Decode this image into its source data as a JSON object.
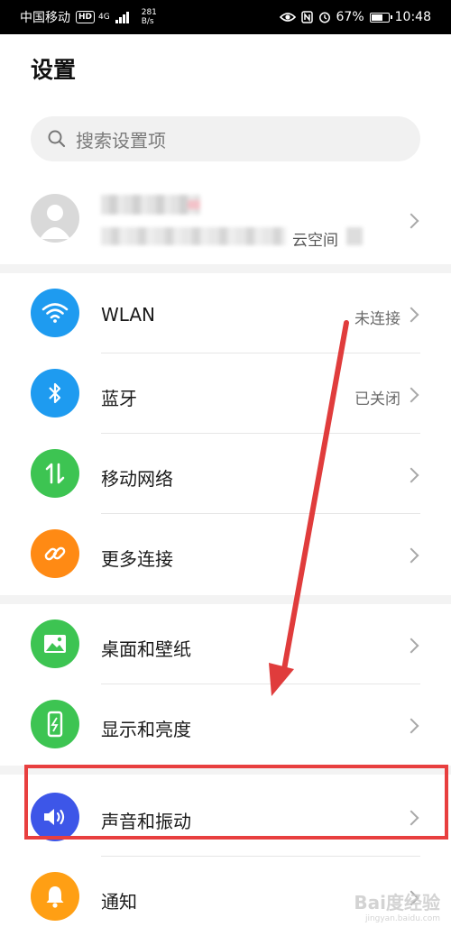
{
  "status_bar": {
    "carrier": "中国移动",
    "hd_badge": "HD",
    "network": "4G",
    "speed_value": "281",
    "speed_unit": "B/s",
    "battery": "67%",
    "time": "10:48",
    "icons": [
      "eye-comfort-icon",
      "nfc-icon",
      "alarm-icon",
      "battery-icon"
    ]
  },
  "page": {
    "title": "设置"
  },
  "search": {
    "placeholder": "搜索设置项"
  },
  "account": {
    "sub_text_visible": "云空间"
  },
  "groups": [
    {
      "items": [
        {
          "id": "wlan",
          "label": "WLAN",
          "status": "未连接",
          "icon": "wifi-icon",
          "color": "#1e9bf0"
        },
        {
          "id": "bluetooth",
          "label": "蓝牙",
          "status": "已关闭",
          "icon": "bluetooth-icon",
          "color": "#1e9bf0"
        },
        {
          "id": "mobile-network",
          "label": "移动网络",
          "status": "",
          "icon": "mobile-data-icon",
          "color": "#3dc452"
        },
        {
          "id": "more-connections",
          "label": "更多连接",
          "status": "",
          "icon": "link-icon",
          "color": "#ff8a14"
        }
      ]
    },
    {
      "items": [
        {
          "id": "home-wallpaper",
          "label": "桌面和壁纸",
          "status": "",
          "icon": "image-icon",
          "color": "#3dc452"
        },
        {
          "id": "display",
          "label": "显示和亮度",
          "status": "",
          "icon": "phone-brightness-icon",
          "color": "#3dc452"
        }
      ]
    },
    {
      "items": [
        {
          "id": "sound",
          "label": "声音和振动",
          "status": "",
          "icon": "speaker-icon",
          "color": "#3d56e8"
        },
        {
          "id": "notifications",
          "label": "通知",
          "status": "",
          "icon": "bell-icon",
          "color": "#ff9f14"
        }
      ]
    }
  ],
  "annotation": {
    "arrow_color": "#e03c3c",
    "box_color": "#e83f3f"
  },
  "watermark": {
    "text": "Bai度经验",
    "url": "jingyan.baidu.com"
  }
}
